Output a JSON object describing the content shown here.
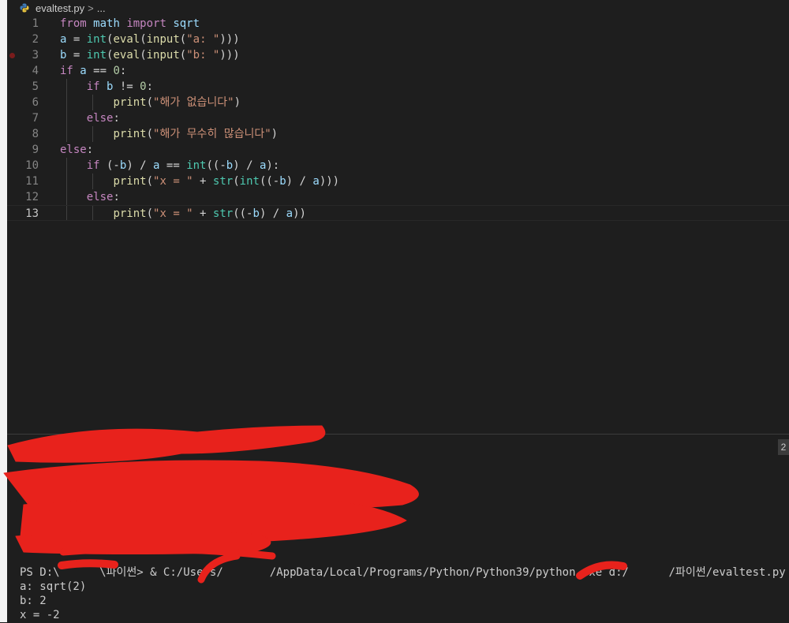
{
  "breadcrumb": {
    "file": "evaltest.py",
    "separator": ">",
    "more": "..."
  },
  "editor": {
    "breakpoint_line": 3,
    "current_line": 13,
    "lines": [
      {
        "num": "1",
        "text": "from math import sqrt"
      },
      {
        "num": "2",
        "text": "a = int(eval(input(\"a: \")))"
      },
      {
        "num": "3",
        "text": "b = int(eval(input(\"b: \")))"
      },
      {
        "num": "4",
        "text": "if a == 0:"
      },
      {
        "num": "5",
        "text": "    if b != 0:"
      },
      {
        "num": "6",
        "text": "        print(\"해가 없습니다\")"
      },
      {
        "num": "7",
        "text": "    else:"
      },
      {
        "num": "8",
        "text": "        print(\"해가 무수히 많습니다\")"
      },
      {
        "num": "9",
        "text": "else:"
      },
      {
        "num": "10",
        "text": "    if (-b) / a == int((-b) / a):"
      },
      {
        "num": "11",
        "text": "        print(\"x = \" + str(int((-b) / a)))"
      },
      {
        "num": "12",
        "text": "    else:"
      },
      {
        "num": "13",
        "text": "        print(\"x = \" + str((-b) / a))"
      }
    ]
  },
  "terminal": {
    "badge": "2",
    "lines": [
      "PS D:\\      \\파이썬> & C:/Users/       /AppData/Local/Programs/Python/Python39/python.exe d:/      /파이썬/evaltest.py",
      "a: sqrt(2)",
      "b: 2",
      "x = -2"
    ]
  },
  "colors": {
    "background": "#1e1e1e",
    "keyword": "#c586c0",
    "function": "#dcdcaa",
    "builtin": "#4ec9b0",
    "string": "#ce9178",
    "number": "#b5cea8",
    "redaction": "#e8221c"
  },
  "icons": {
    "file_type": "python-file-icon"
  }
}
